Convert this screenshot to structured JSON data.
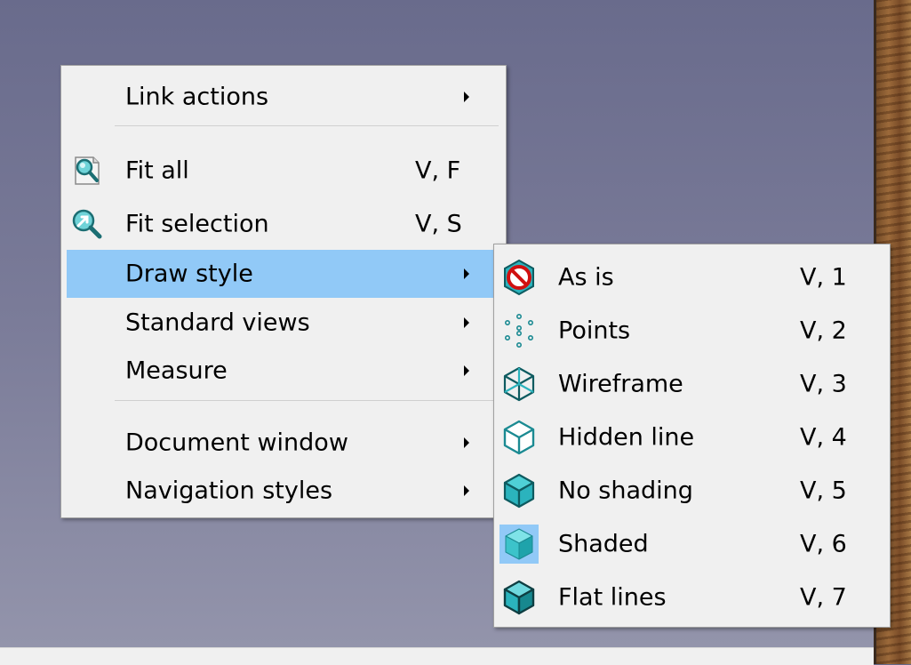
{
  "main_menu": {
    "items": [
      {
        "label": "Link actions",
        "shortcut": "",
        "submenu": true
      },
      {
        "label": "Fit all",
        "shortcut": "V, F",
        "icon": "fit-all-icon"
      },
      {
        "label": "Fit selection",
        "shortcut": "V, S",
        "icon": "fit-selection-icon"
      },
      {
        "label": "Draw style",
        "shortcut": "",
        "submenu": true,
        "highlighted": true
      },
      {
        "label": "Standard views",
        "shortcut": "",
        "submenu": true
      },
      {
        "label": "Measure",
        "shortcut": "",
        "submenu": true
      },
      {
        "label": "Document window",
        "shortcut": "",
        "submenu": true
      },
      {
        "label": "Navigation styles",
        "shortcut": "",
        "submenu": true
      }
    ]
  },
  "draw_style_menu": {
    "items": [
      {
        "label": "As is",
        "shortcut": "V, 1",
        "icon": "as-is-icon"
      },
      {
        "label": "Points",
        "shortcut": "V, 2",
        "icon": "points-icon"
      },
      {
        "label": "Wireframe",
        "shortcut": "V, 3",
        "icon": "wireframe-icon"
      },
      {
        "label": "Hidden line",
        "shortcut": "V, 4",
        "icon": "hidden-line-icon"
      },
      {
        "label": "No shading",
        "shortcut": "V, 5",
        "icon": "no-shading-icon"
      },
      {
        "label": "Shaded",
        "shortcut": "V, 6",
        "icon": "shaded-icon",
        "checked": true
      },
      {
        "label": "Flat lines",
        "shortcut": "V, 7",
        "icon": "flat-lines-icon"
      }
    ]
  },
  "colors": {
    "menu_bg": "#f0f0f0",
    "highlight": "#91c9f7",
    "icon_teal": "#2bb3bd",
    "icon_dark": "#0e5b60"
  }
}
